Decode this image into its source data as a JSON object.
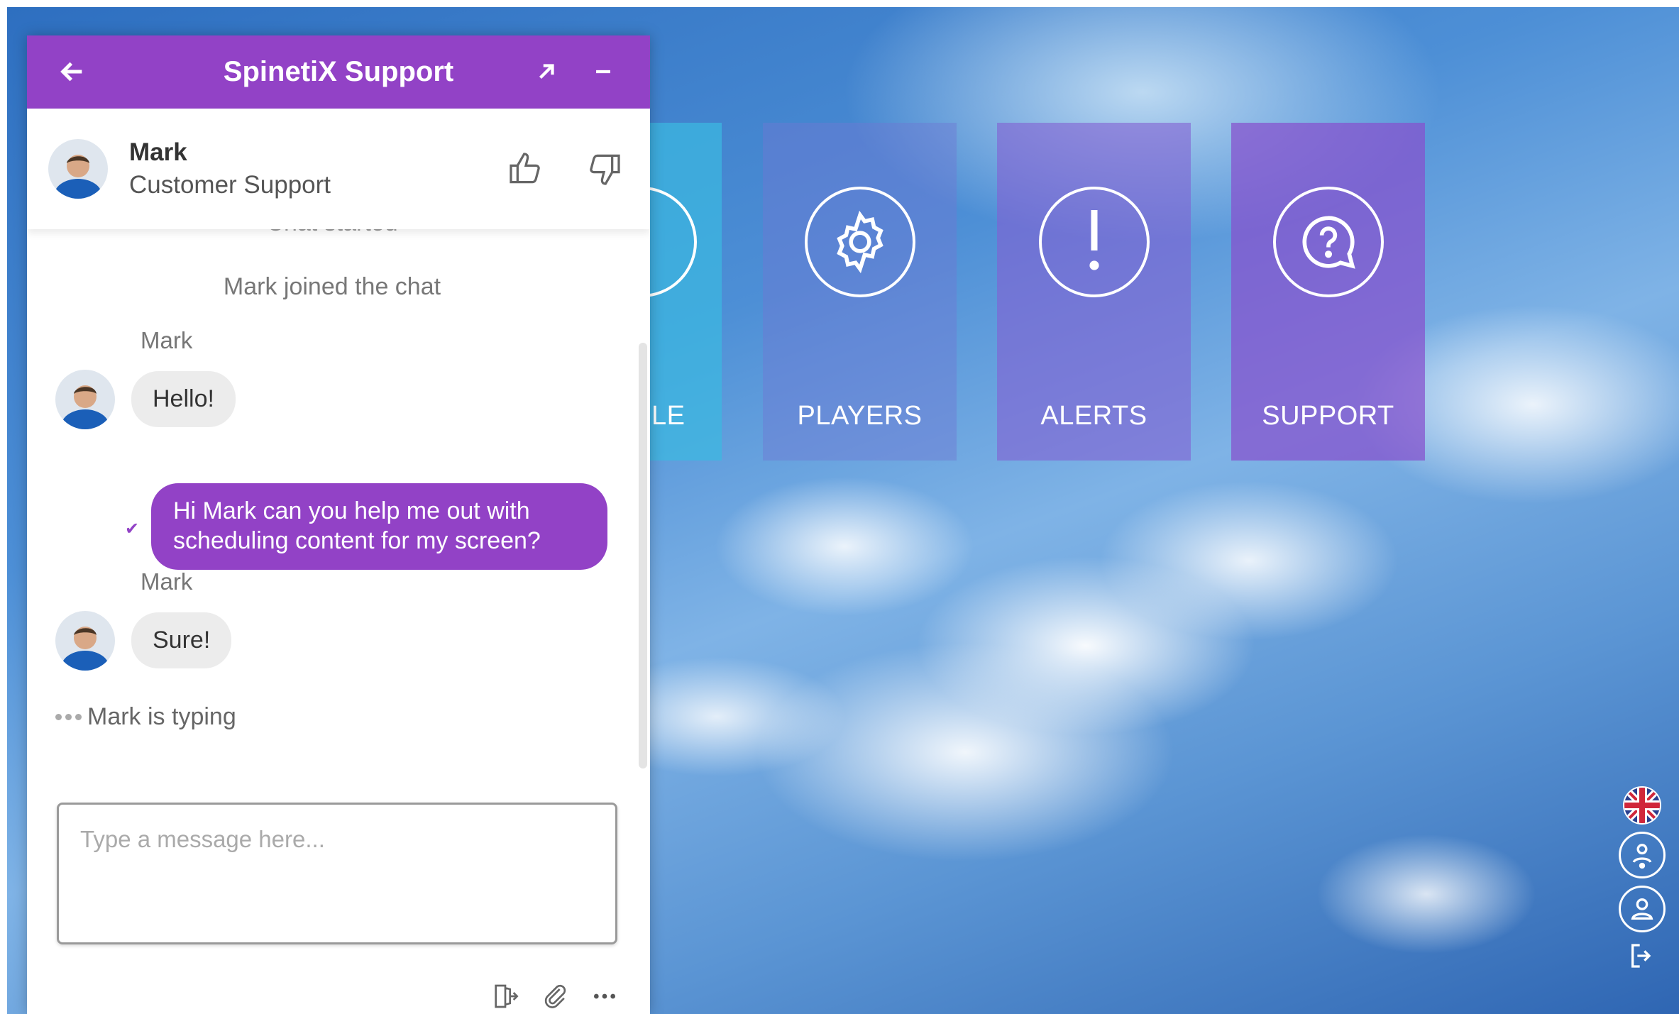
{
  "tiles": {
    "schedule_label": "ULE",
    "players_label": "PLAYERS",
    "alerts_label": "ALERTS",
    "support_label": "SUPPORT"
  },
  "chat": {
    "title": "SpinetiX Support",
    "agent": {
      "name": "Mark",
      "role": "Customer Support"
    },
    "system_partial": "Chat started",
    "system_joined": "Mark joined the chat",
    "messages": [
      {
        "sender": "Mark",
        "text": "Hello!"
      },
      {
        "text": "Hi Mark can you help me out with scheduling content for my screen?"
      },
      {
        "sender": "Mark",
        "text": "Sure!"
      }
    ],
    "typing": "Mark is typing",
    "input_placeholder": "Type a message here..."
  },
  "colors": {
    "accent": "#9242c6",
    "bubble_in": "#ececec"
  },
  "icons": [
    "back-arrow-icon",
    "popout-icon",
    "minimize-icon",
    "thumbs-up-icon",
    "thumbs-down-icon",
    "exit-icon",
    "paperclip-icon",
    "more-icon",
    "gear-icon",
    "exclamation-icon",
    "question-chat-icon",
    "uk-flag-icon",
    "user-settings-icon",
    "user-icon",
    "logout-icon"
  ]
}
